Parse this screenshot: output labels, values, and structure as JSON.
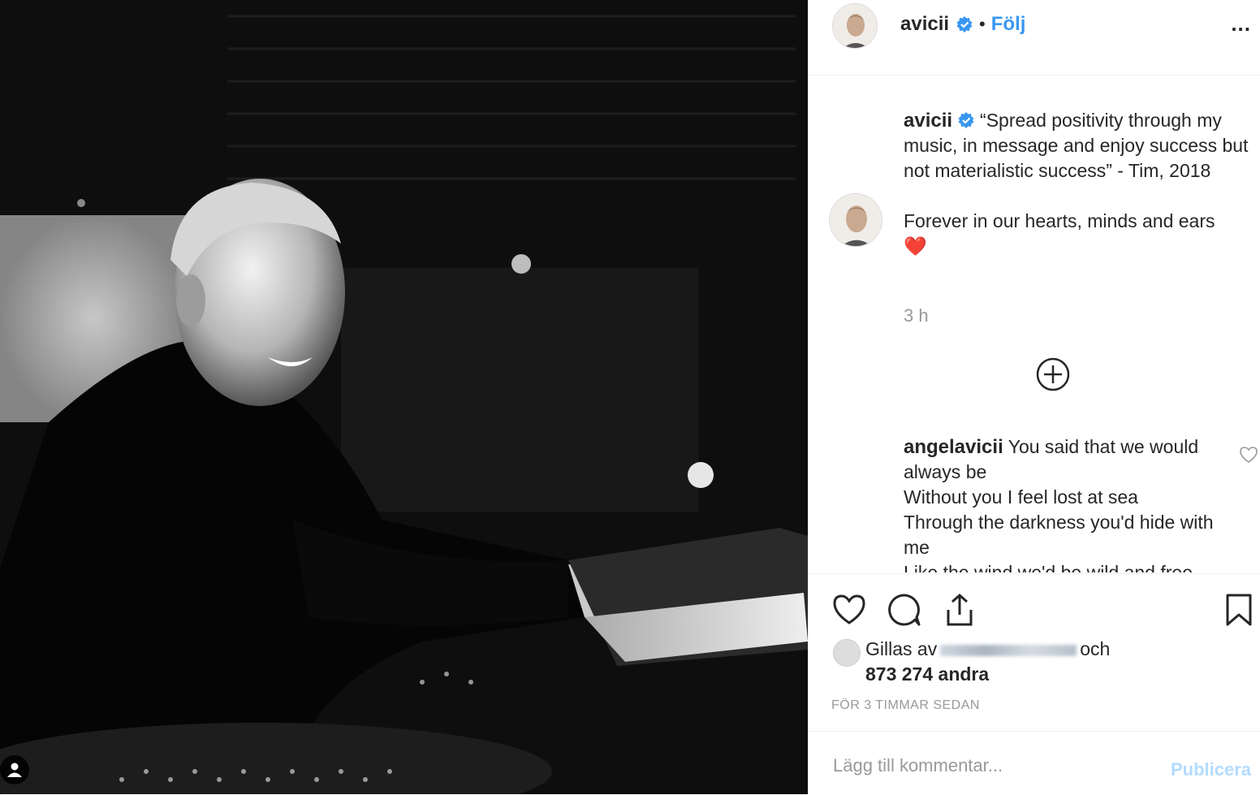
{
  "post": {
    "username": "avicii",
    "follow_label": "Följ",
    "dot": "•",
    "more_label": "...",
    "caption_username": "avicii",
    "caption_text": "“Spread positivity through my music, in message and enjoy success but not materialistic success” - Tim, 2018",
    "caption_text2": "Forever in our hearts, minds and ears",
    "caption_emoji": "❤️",
    "time_ago": "3 h",
    "comment": {
      "username": "angelavicii",
      "text_line1": "You said that we would always be",
      "text_line2": "Without you I feel lost at sea",
      "text_line3": "Through the darkness you'd hide with me",
      "text_line4": "Like the wind we'd be wild and free"
    },
    "likes_prefix": "Gillas av",
    "likes_suffix": "och",
    "likes_count": "873 274 andra",
    "posted_time": "FÖR 3 TIMMAR SEDAN",
    "add_comment_placeholder": "Lägg till kommentar...",
    "publish_label": "Publicera"
  },
  "colors": {
    "accent": "#3897f0",
    "publish_disabled": "#b3dbff",
    "muted": "#999999"
  },
  "icons": [
    "verified-icon",
    "heart-icon",
    "comment-icon",
    "share-icon",
    "bookmark-icon",
    "load-more-icon",
    "user-tag-icon"
  ]
}
